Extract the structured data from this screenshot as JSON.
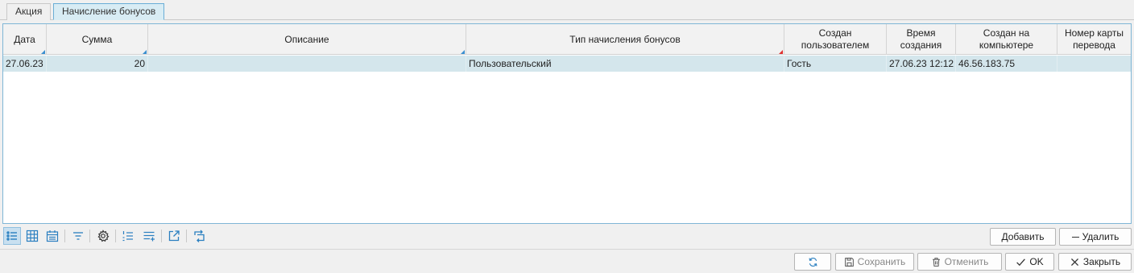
{
  "tabs": [
    {
      "label": "Акция",
      "active": false
    },
    {
      "label": "Начисление бонусов",
      "active": true
    }
  ],
  "grid": {
    "columns": [
      {
        "label": "Дата"
      },
      {
        "label": "Сумма"
      },
      {
        "label": "Описание"
      },
      {
        "label": "Тип начисления бонусов"
      },
      {
        "label": "Создан пользователем"
      },
      {
        "label": "Время создания"
      },
      {
        "label": "Создан на компьютере"
      },
      {
        "label": "Номер карты перевода"
      }
    ],
    "rows": [
      {
        "date": "27.06.23",
        "sum": "20",
        "description": "",
        "type": "Пользовательский",
        "user": "Гость",
        "time": "27.06.23 12:12",
        "computer": "46.56.183.75",
        "card": ""
      }
    ]
  },
  "toolbar": {
    "icons": [
      "list-view-icon",
      "grid-view-icon",
      "calendar-view-icon",
      "filter-icon",
      "settings-icon",
      "numbered-list-icon",
      "add-list-icon",
      "export-icon",
      "transfer-icon"
    ],
    "add_label": "Добавить",
    "delete_label": "Удалить"
  },
  "footer": {
    "save_label": "Сохранить",
    "cancel_label": "Отменить",
    "ok_label": "OK",
    "close_label": "Закрыть"
  },
  "colors": {
    "accent": "#3a8fd0",
    "selected_row": "#d4e6ec",
    "active_tab": "#d8ecf4",
    "sort_marker_red": "#e03030"
  }
}
